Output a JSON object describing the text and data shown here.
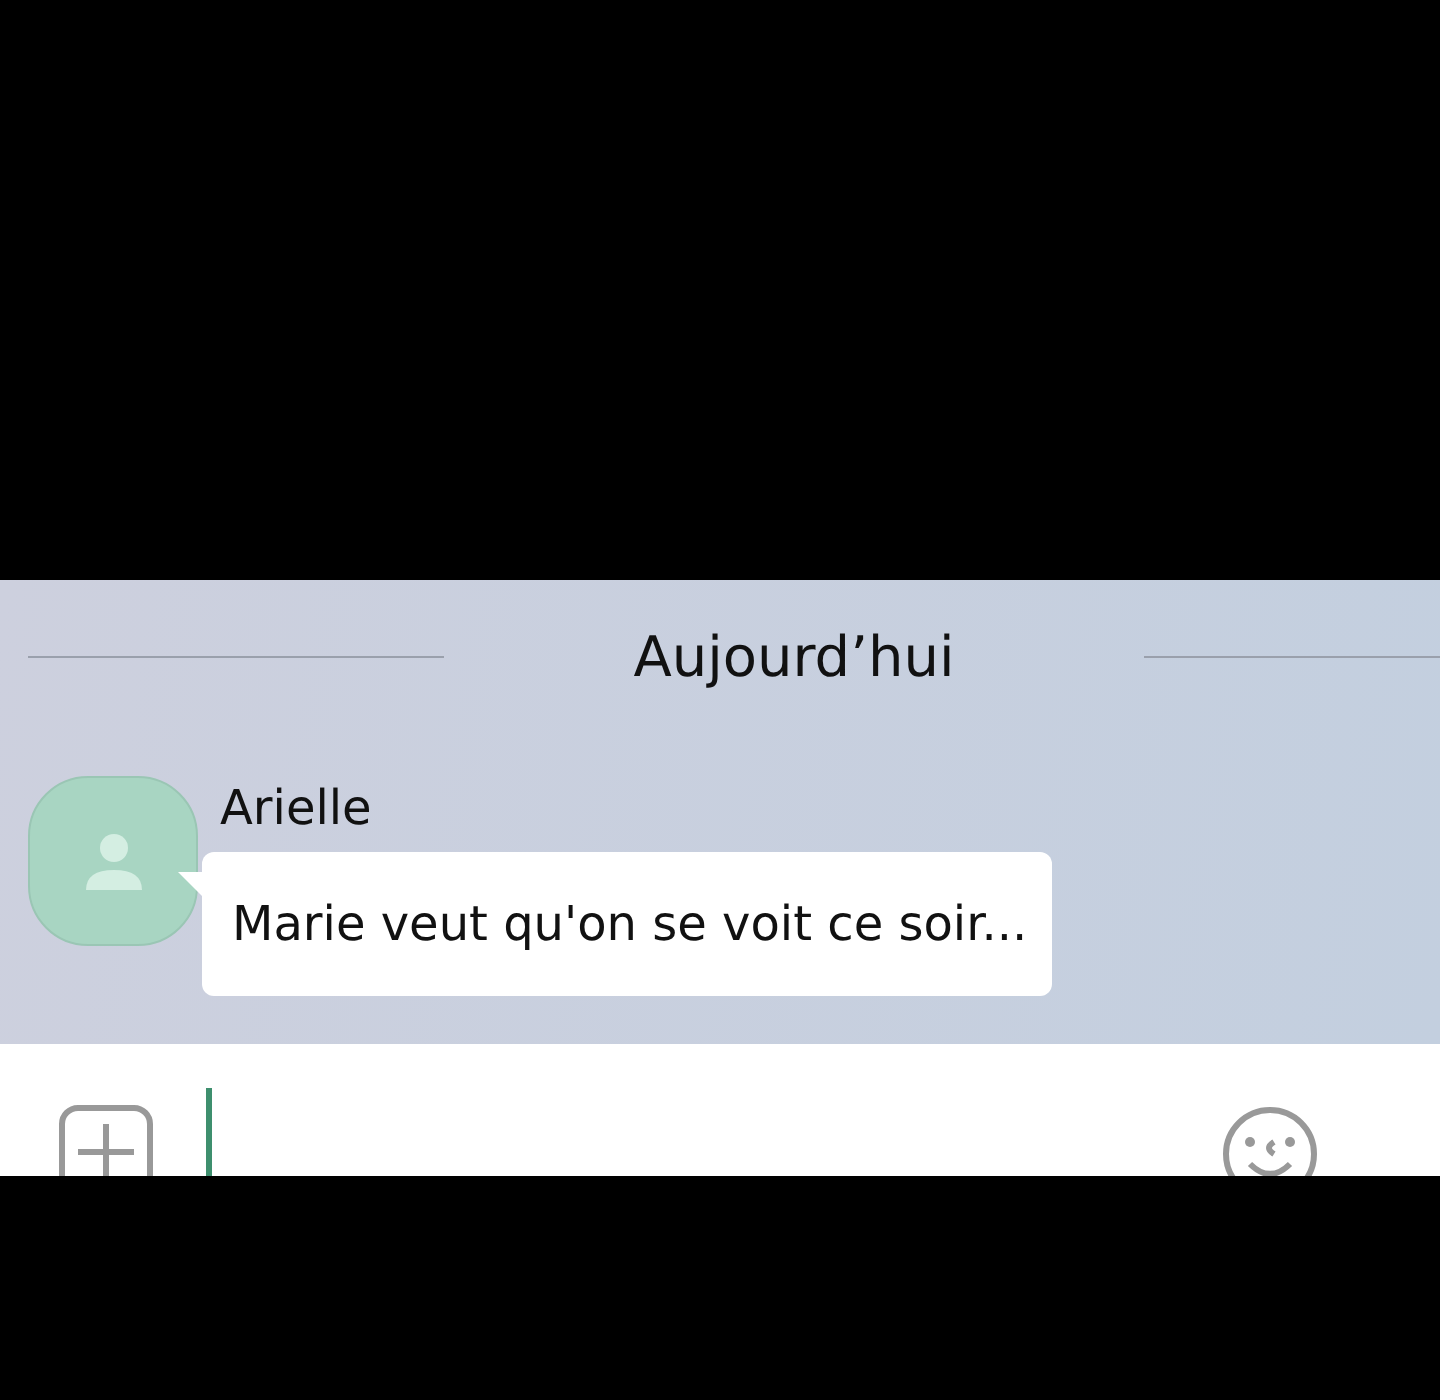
{
  "date_divider": "Aujourd’hui",
  "messages": [
    {
      "sender": "Arielle",
      "text": "Marie veut qu'on se voit ce soir..."
    }
  ]
}
